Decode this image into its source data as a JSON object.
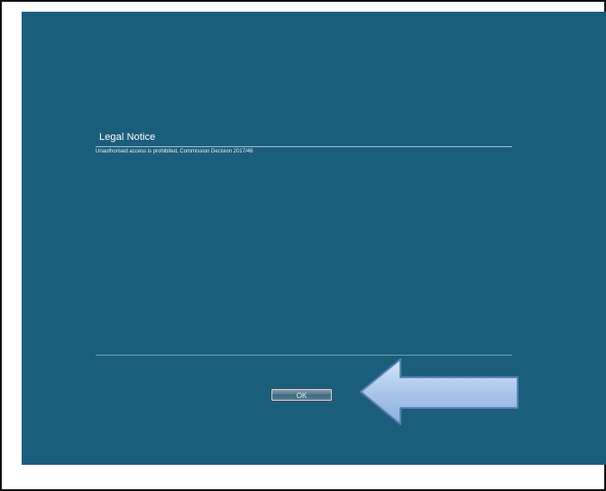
{
  "dialog": {
    "title": "Legal Notice",
    "message": "Unauthorised access is prohibited, Commission Decision 2017/46",
    "ok_label": "OK"
  },
  "colors": {
    "screen_background": "#1b5e7c",
    "arrow_fill": "#a9c6ea",
    "arrow_stroke": "#5b7fb8"
  },
  "annotation": {
    "icon": "left-arrow-icon",
    "points_to": "ok-button"
  }
}
